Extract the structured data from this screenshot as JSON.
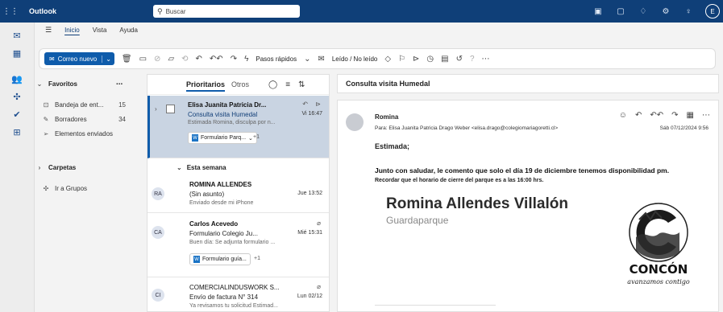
{
  "titlebar": {
    "app_title": "Outlook",
    "search_placeholder": "Buscar",
    "avatar_initial": "E"
  },
  "menu": {
    "tabs": [
      "Inicio",
      "Vista",
      "Ayuda"
    ],
    "active_tab": "Inicio"
  },
  "ribbon": {
    "new_mail": "Correo nuevo",
    "quick_steps": "Pasos rápidos",
    "read_unread": "Leído / No leído"
  },
  "folders": {
    "favorites_label": "Favoritos",
    "items": [
      {
        "label": "Bandeja de ent...",
        "count": "15"
      },
      {
        "label": "Borradores",
        "count": "34"
      },
      {
        "label": "Elementos enviados",
        "count": ""
      }
    ],
    "carpetas_label": "Carpetas",
    "groups_label": "Ir a Grupos"
  },
  "list": {
    "tab_focused": "Prioritarios",
    "tab_other": "Otros",
    "section_label": "Esta semana",
    "messages": [
      {
        "from": "Elisa Juanita Patricia Dr...",
        "subject": "Consulta visita Humedal",
        "time": "Vi 16:47",
        "preview": "Estimada Romina, disculpa por n...",
        "attachment": "Formulario Parq...",
        "more": "+1",
        "initials": ""
      },
      {
        "from": "ROMINA ALLENDES",
        "subject": "(Sin asunto)",
        "time": "Jue 13:52",
        "preview": "Enviado desde mi iPhone",
        "attachment": "",
        "more": "",
        "initials": "RA"
      },
      {
        "from": "Carlos Acevedo",
        "subject": "Formulario Colegio Ju...",
        "time": "Mié 15:31",
        "preview": "Buen día: Se adjunta formulario ...",
        "attachment": "Formulario guía...",
        "more": "+1",
        "initials": "CA"
      },
      {
        "from": "COMERCIALINDUSWORK S...",
        "subject": "Envío de factura N° 314",
        "time": "Lun 02/12",
        "preview": "Ya revisamos tu solicitud Estimad...",
        "attachment": "",
        "more": "",
        "initials": "CI"
      }
    ]
  },
  "reading": {
    "subject": "Consulta visita Humedal",
    "from": "Romina",
    "to": "Para: Elisa Juanita Patricia Drago Weber <elisa.drago@colegiomariagoretti.cl>",
    "date": "Sáb 07/12/2024 9:56",
    "greeting": "Estimada;",
    "body1": "Junto con saludar, le comento que solo el día 19 de diciembre tenemos disponibilidad pm.",
    "body2": "Recordar que el horario de cierre del parque es a las 16:00 hrs.",
    "signature_name": "Romina Allendes Villalón",
    "signature_role": "Guardaparque",
    "logo_text": "CONCÓN",
    "logo_tagline": "avanzamos contigo"
  }
}
